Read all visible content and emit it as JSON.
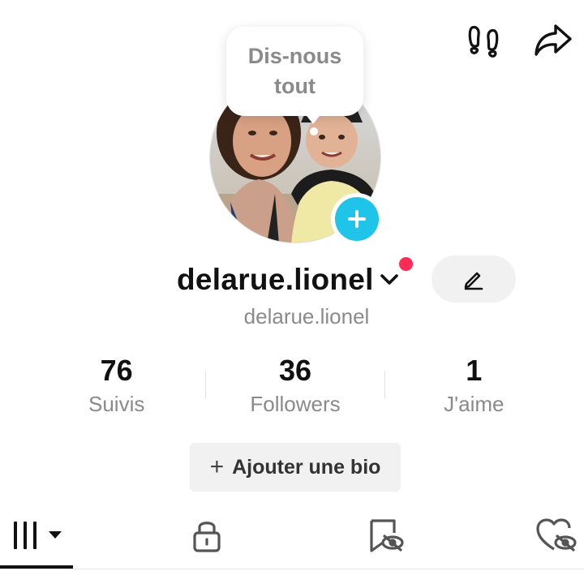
{
  "header": {
    "footprints_icon": "footprints-icon",
    "share_icon": "share-arrow-icon"
  },
  "prompt_bubble": {
    "line1": "Dis-nous",
    "line2": "tout"
  },
  "profile": {
    "username": "delarue.lionel",
    "handle": "delarue.lionel",
    "edit_icon": "pencil-icon",
    "add_avatar_icon": "plus-icon"
  },
  "stats": [
    {
      "value": "76",
      "label": "Suivis"
    },
    {
      "value": "36",
      "label": "Followers"
    },
    {
      "value": "1",
      "label": "J'aime"
    }
  ],
  "bio_button": {
    "icon": "+",
    "label": "Ajouter une bio"
  },
  "tabs": [
    {
      "icon": "grid-videos-icon",
      "active": true
    },
    {
      "icon": "lock-icon",
      "active": false
    },
    {
      "icon": "bookmark-hidden-icon",
      "active": false
    },
    {
      "icon": "heart-hidden-icon",
      "active": false
    }
  ],
  "colors": {
    "accent_cyan": "#20c4e8",
    "notification_red": "#fe2c55",
    "text_primary": "#111111",
    "text_secondary": "#8a8a8a",
    "button_bg": "#f1f1f2"
  }
}
